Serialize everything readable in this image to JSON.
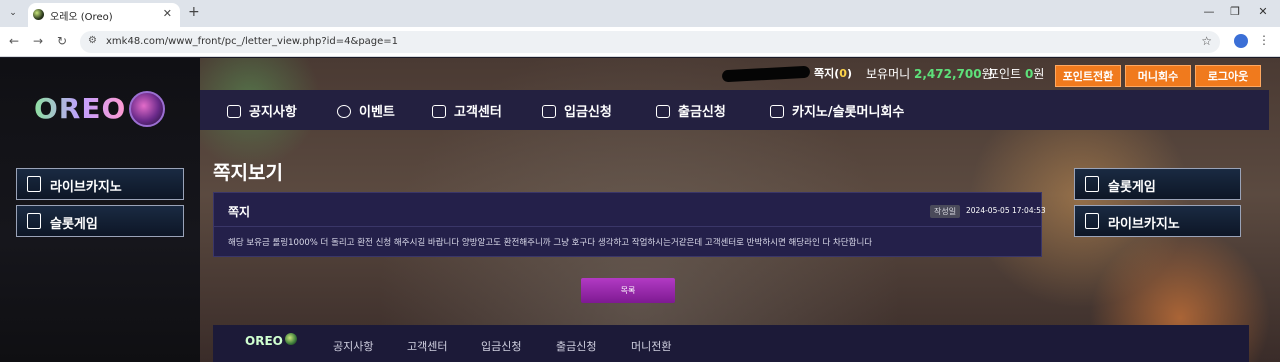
{
  "browser": {
    "tab_title": "오레오 (Oreo)",
    "url": "xmk48.com/www_front/pc_/letter_view.php?id=4&page=1"
  },
  "site": {
    "logo": "OREO"
  },
  "topbar": {
    "letter_label": "쪽지",
    "letter_count": "0",
    "money_label": "보유머니",
    "money_value": "2,472,700",
    "money_unit": "원",
    "point_label": "포인트",
    "point_value": "0",
    "point_unit": "원",
    "buttons": [
      "포인트전환",
      "머니회수",
      "로그아웃"
    ]
  },
  "mainnav": [
    "공지사항",
    "이벤트",
    "고객센터",
    "입금신청",
    "출금신청",
    "카지노/슬롯머니회수"
  ],
  "left_side": [
    "라이브카지노",
    "슬롯게임"
  ],
  "right_side": [
    "슬롯게임",
    "라이브카지노"
  ],
  "page_title": "쪽지보기",
  "letter": {
    "subject": "쪽지",
    "date_label": "작성일",
    "date": "2024-05-05 17:04:53",
    "body": "해당 보유금 롤링1000% 더 돌리고 환전 신청 해주시길 바랍니다 양방알고도 환전해주니까 그냥 호구다 생각하고 작업하시는거같은데 고객센터로 반박하시면 해당라인 다 차단합니다"
  },
  "list_button": "목록",
  "footer": {
    "logo": "OREO",
    "links": [
      "공지사항",
      "고객센터",
      "입금신청",
      "출금신청",
      "머니전환"
    ]
  },
  "colors": {
    "accent_orange": "#f07a1d",
    "money_green": "#5ee07a",
    "nav_bg": "#232040",
    "list_button": "#9a2aae"
  }
}
